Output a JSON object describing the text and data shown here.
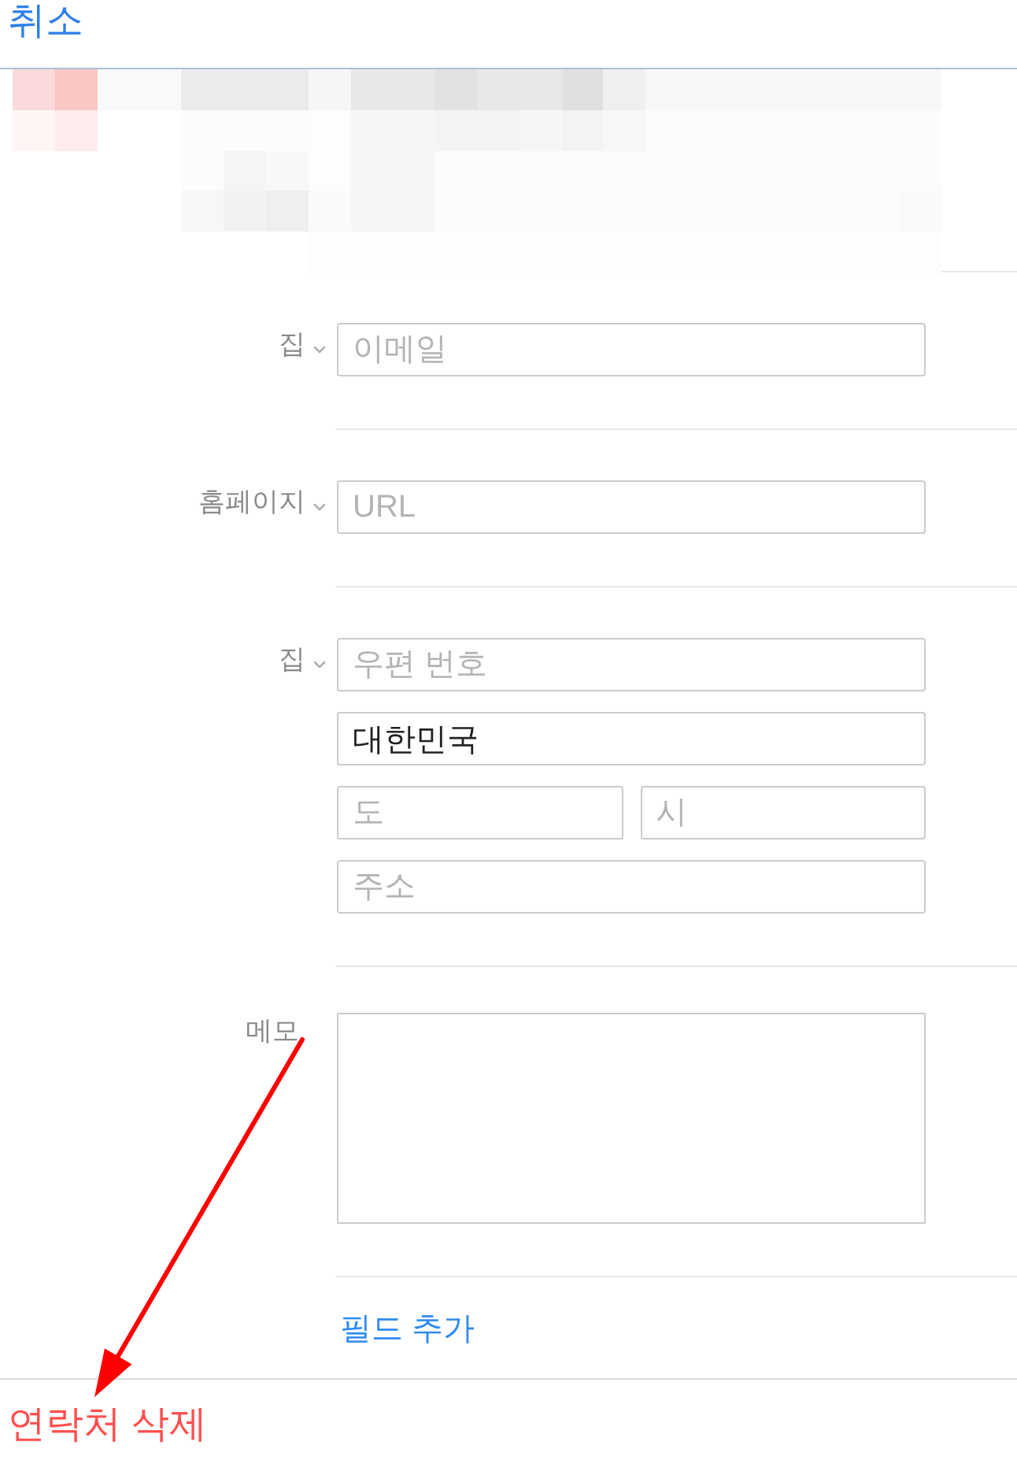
{
  "header": {
    "cancel": "취소"
  },
  "sections": [
    {
      "kind": "field",
      "label": "집",
      "lines": [
        [
          {
            "placeholder": "이메일"
          }
        ]
      ]
    },
    {
      "kind": "field",
      "label": "홈페이지",
      "lines": [
        [
          {
            "placeholder": "URL"
          }
        ]
      ]
    },
    {
      "kind": "field",
      "label": "집",
      "lines": [
        [
          {
            "placeholder": "우편 번호"
          }
        ],
        [
          {
            "value": "대한민국"
          }
        ],
        [
          {
            "placeholder": "도"
          },
          {
            "placeholder": "시"
          }
        ],
        [
          {
            "placeholder": "주소"
          }
        ]
      ]
    },
    {
      "kind": "note",
      "label": "메모"
    }
  ],
  "add_field": "필드 추가",
  "delete_contact": "연락처 삭제"
}
